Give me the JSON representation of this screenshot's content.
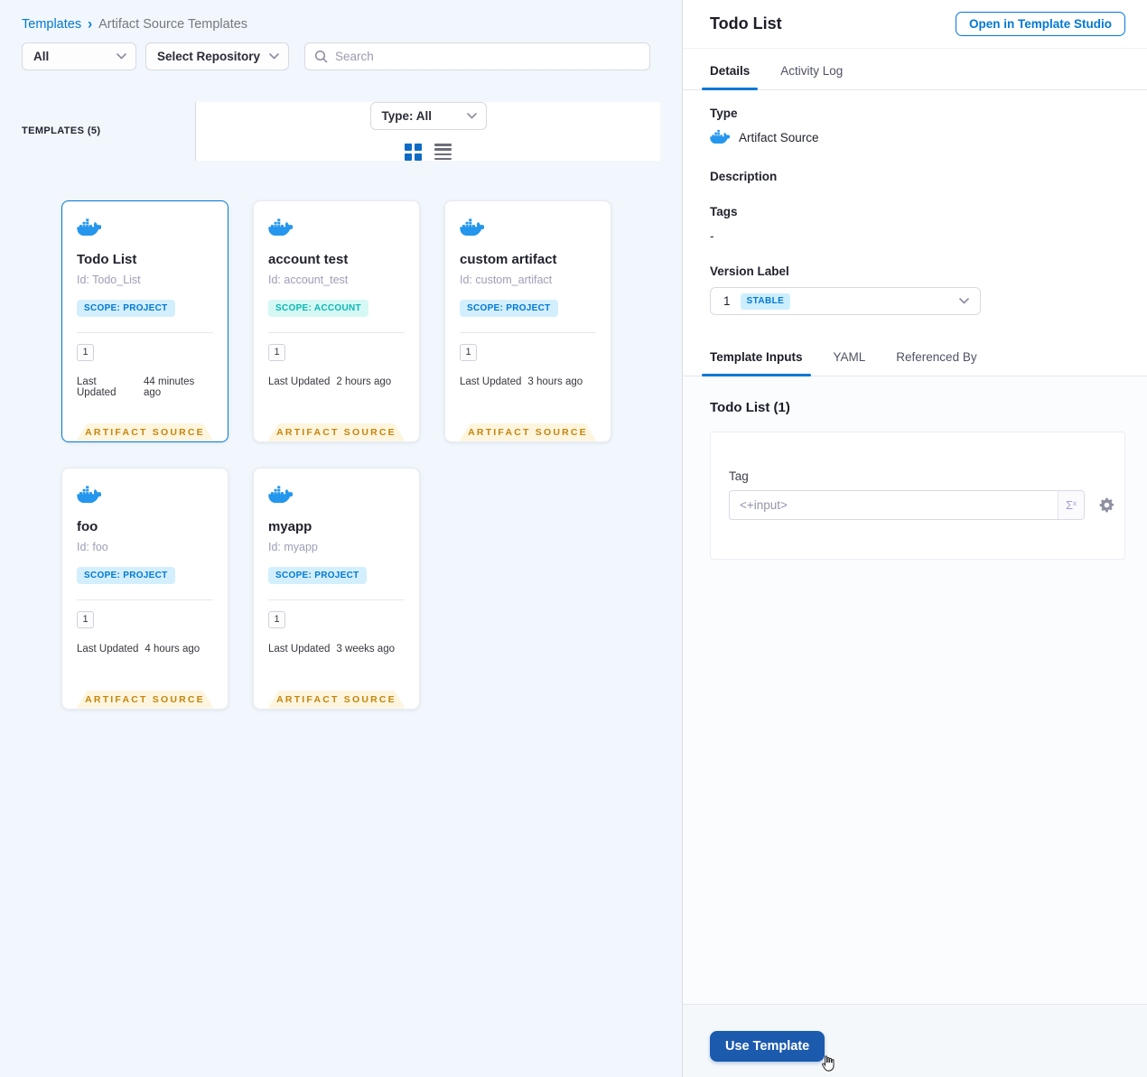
{
  "breadcrumb": {
    "parent": "Templates",
    "separator": "›",
    "current": "Artifact Source Templates"
  },
  "filters": {
    "scope": "All",
    "repository": "Select Repository",
    "search_placeholder": "Search"
  },
  "list_header": {
    "count_label": "TEMPLATES (5)",
    "type_filter": "Type: All"
  },
  "cards": [
    {
      "name": "Todo List",
      "id_label": "Id: Todo_List",
      "scope": "SCOPE: PROJECT",
      "version_count": "1",
      "last_updated_label": "Last Updated",
      "last_updated": "44 minutes ago",
      "ribbon": "ARTIFACT SOURCE"
    },
    {
      "name": "account test",
      "id_label": "Id: account_test",
      "scope": "SCOPE: ACCOUNT",
      "version_count": "1",
      "last_updated_label": "Last Updated",
      "last_updated": "2 hours ago",
      "ribbon": "ARTIFACT SOURCE"
    },
    {
      "name": "custom artifact",
      "id_label": "Id: custom_artifact",
      "scope": "SCOPE: PROJECT",
      "version_count": "1",
      "last_updated_label": "Last Updated",
      "last_updated": "3 hours ago",
      "ribbon": "ARTIFACT SOURCE"
    },
    {
      "name": "foo",
      "id_label": "Id: foo",
      "scope": "SCOPE: PROJECT",
      "version_count": "1",
      "last_updated_label": "Last Updated",
      "last_updated": "4 hours ago",
      "ribbon": "ARTIFACT SOURCE"
    },
    {
      "name": "myapp",
      "id_label": "Id: myapp",
      "scope": "SCOPE: PROJECT",
      "version_count": "1",
      "last_updated_label": "Last Updated",
      "last_updated": "3 weeks ago",
      "ribbon": "ARTIFACT SOURCE"
    }
  ],
  "panel": {
    "title": "Todo List",
    "open_button": "Open in Template Studio",
    "tabs": {
      "details": "Details",
      "activity_log": "Activity Log"
    },
    "details": {
      "type_label": "Type",
      "type_value": "Artifact Source",
      "description_label": "Description",
      "tags_label": "Tags",
      "tags_value": "-",
      "version_label": "Version Label",
      "version_number": "1",
      "version_badge": "STABLE"
    },
    "inputs_tabs": {
      "template_inputs": "Template Inputs",
      "yaml": "YAML",
      "referenced_by": "Referenced By"
    },
    "inputs": {
      "heading": "Todo List (1)",
      "tag_label": "Tag",
      "tag_value": "<+input>"
    },
    "footer": {
      "use_template": "Use Template"
    }
  },
  "colors": {
    "accent_blue": "#0278d5",
    "docker_blue": "#2496ed",
    "scope_project_text": "#0278d5",
    "scope_project_bg": "#d3effd",
    "scope_account_text": "#0ab8b4",
    "scope_account_bg": "#d5f8f4",
    "ribbon_text": "#c5850d",
    "ribbon_bg": "#fdf5de",
    "stable_badge_bg": "#cdeffd",
    "use_template_bg": "#1c5aad",
    "left_panel_bg": "#f1f7fc",
    "inputs_bg": "#fafcfe"
  }
}
